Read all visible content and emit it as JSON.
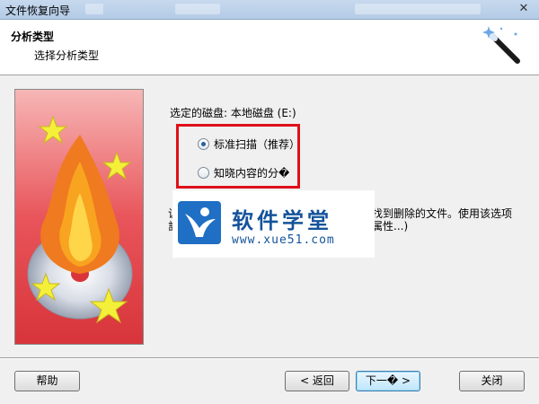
{
  "window": {
    "title": "文件恢复向导",
    "close_glyph": "✕"
  },
  "header": {
    "title": "分析类型",
    "subtitle": "选择分析类型"
  },
  "selected_disk_label": "选定的磁盘: 本地磁盘 (E:)",
  "options": [
    {
      "label": "标准扫描（推荐）",
      "selected": true
    },
    {
      "label": "知晓内容的分�",
      "selected": false
    }
  ],
  "description": {
    "line1_left": "让",
    "line1_right": "找到删除的文件。使用该选项",
    "line2_left": "計",
    "line2_right": "属性...)"
  },
  "watermark": {
    "title": "软件学堂",
    "url": "www.xue51.com"
  },
  "buttons": {
    "help": "帮助",
    "back": "< 返回",
    "next": "下一� >",
    "close": "关闭"
  },
  "colors": {
    "highlight_box": "#e0101a",
    "side_panel": "#e24c4c",
    "header_bg": "#ffffff"
  }
}
